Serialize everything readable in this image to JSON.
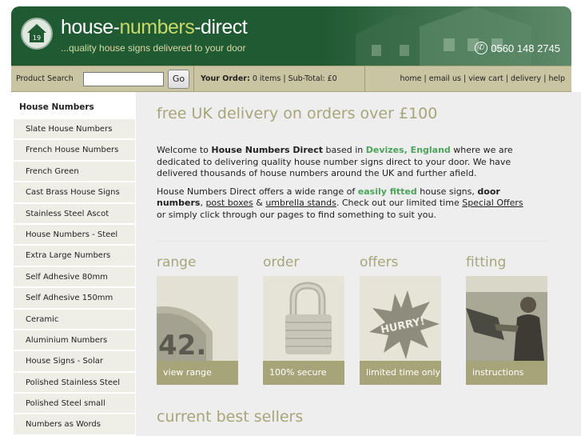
{
  "header": {
    "logo_text_1": "house-",
    "logo_text_2": "numbers",
    "logo_text_3": "-direct",
    "tagline": "...quality house signs delivered to your door",
    "phone": "0560 148 2745",
    "badge_number": "19"
  },
  "toolbar": {
    "search_label": "Product Search",
    "search_value": "",
    "go_label": "Go",
    "order_label": "Your Order:",
    "order_items": "0 items",
    "order_subtotal": "Sub-Total: £0",
    "links": [
      "home",
      "email us",
      "view cart",
      "delivery",
      "help"
    ]
  },
  "sidebar": {
    "heading": "House Numbers",
    "items": [
      "Slate House Numbers",
      "French House Numbers",
      "French Green",
      "Cast Brass House Signs",
      "Stainless Steel Ascot",
      "House Numbers - Steel",
      "Extra Large Numbers",
      "Self Adhesive 80mm",
      "Self Adhesive 150mm",
      "Ceramic",
      "Aluminium Numbers",
      "House Signs - Solar",
      "Polished Stainless Steel",
      "Polished Steel small",
      "Numbers as Words"
    ]
  },
  "main": {
    "promo": "free UK delivery on orders over £100",
    "p1_a": "Welcome to ",
    "p1_brand": "House Numbers Direct",
    "p1_b": " based in ",
    "p1_location": "Devizes, England",
    "p1_c": " where we are dedicated to delivering quality house number signs direct to your door. We have delivered thousands of house numbers around the UK and further afield.",
    "p2_a": "House Numbers Direct offers a wide range of ",
    "p2_easy": "easily fitted",
    "p2_b": " house signs, ",
    "p2_door": "door numbers",
    "p2_c": ", ",
    "p2_postboxes": "post boxes",
    "p2_d": " & ",
    "p2_umbrella": "umbrella stands",
    "p2_e": ".  Check out our limited time ",
    "p2_special": "Special Offers",
    "p2_f": " or simply click through our pages to find something to suit you.",
    "tiles": [
      {
        "title": "range",
        "caption": "view range",
        "image_text": "42."
      },
      {
        "title": "order",
        "caption": "100% secure"
      },
      {
        "title": "offers",
        "caption": "limited time only",
        "image_text": "HURRY!"
      },
      {
        "title": "fitting",
        "caption": "instructions"
      }
    ],
    "bestsellers": "current best sellers"
  },
  "colors": {
    "header_green": "#1f5a33",
    "toolbar_tan": "#c9c4a2",
    "accent_olive": "#a8a57a",
    "highlight_green": "#4ca45a"
  }
}
